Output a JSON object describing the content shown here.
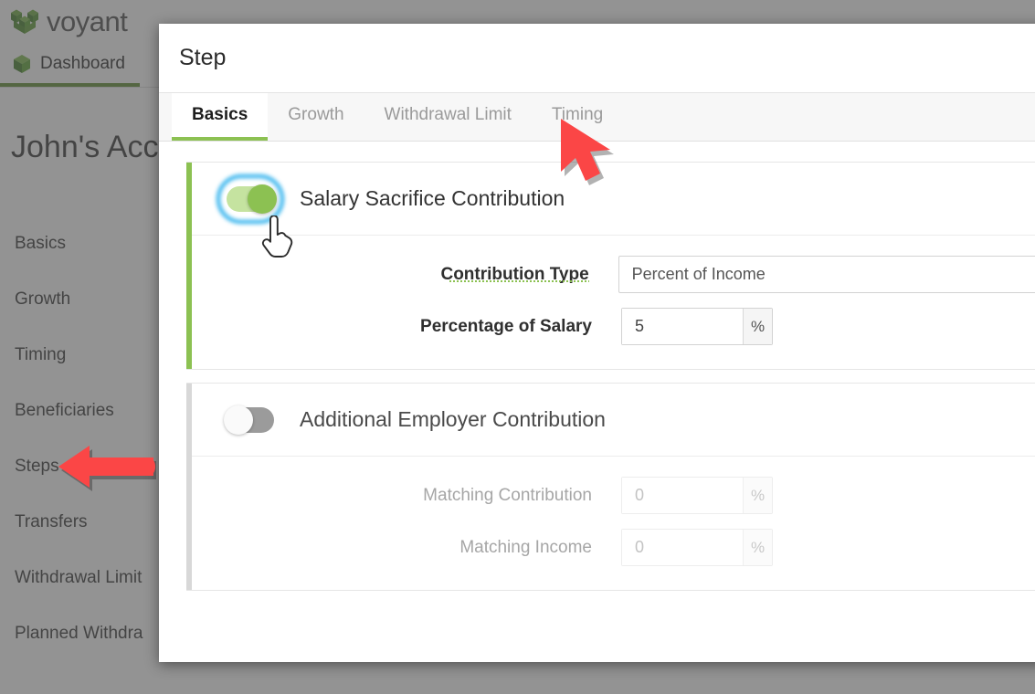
{
  "app": {
    "brand_name": "voyant",
    "brand_color": "#4a7c28",
    "accent_green": "#8cc152",
    "nav_tab_label": "Dashboard",
    "nav_tab_icon": "cube-icon",
    "account_title": "John's Accu"
  },
  "sidebar": {
    "items": [
      {
        "label": "Basics",
        "active": false
      },
      {
        "label": "Growth",
        "active": false
      },
      {
        "label": "Timing",
        "active": false
      },
      {
        "label": "Beneficiaries",
        "active": false
      },
      {
        "label": "Steps",
        "active": true
      },
      {
        "label": "Transfers",
        "active": false
      },
      {
        "label": "Withdrawal Limit",
        "active": false
      },
      {
        "label": "Planned Withdra",
        "active": false
      }
    ]
  },
  "modal": {
    "title": "Step",
    "tabs": [
      {
        "label": "Basics",
        "active": true
      },
      {
        "label": "Growth",
        "active": false
      },
      {
        "label": "Withdrawal Limit",
        "active": false
      },
      {
        "label": "Timing",
        "active": false
      }
    ],
    "sections": [
      {
        "title": "Salary Sacrifice Contribution",
        "toggle_state": "on",
        "toggle_focused": true,
        "fields": [
          {
            "label": "Contribution Type",
            "has_hint_underline": true,
            "control": "select",
            "value": "Percent of Income"
          },
          {
            "label": "Percentage of Salary",
            "has_hint_underline": false,
            "control": "percent",
            "value": "5",
            "suffix": "%"
          }
        ]
      },
      {
        "title": "Additional Employer Contribution",
        "toggle_state": "off",
        "toggle_focused": false,
        "fields": [
          {
            "label": "Matching Contribution",
            "has_hint_underline": false,
            "control": "percent",
            "value": "0",
            "suffix": "%"
          },
          {
            "label": "Matching Income",
            "has_hint_underline": false,
            "control": "percent",
            "value": "0",
            "suffix": "%"
          }
        ]
      }
    ]
  },
  "annotations": {
    "arrow_color": "#fb4646",
    "steps_arrow": "left-arrow pointing at Steps sidebar item",
    "timing_arrow": "cursor-arrow pointing at Timing tab",
    "hand_cursor": "pointing-hand cursor over Salary Sacrifice toggle"
  }
}
